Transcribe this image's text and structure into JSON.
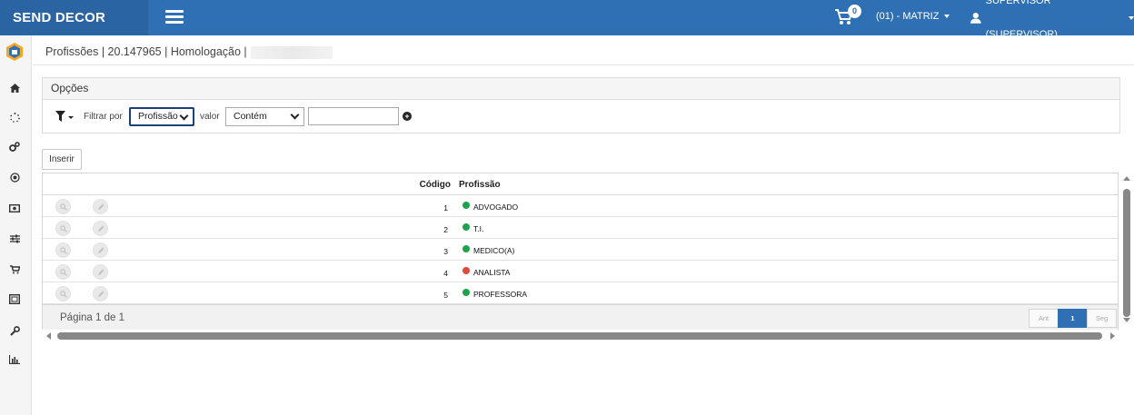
{
  "header": {
    "brand": "SEND DECOR",
    "cart_count": "0",
    "branch": "(01) - MATRIZ",
    "user": "SUPERVISOR (SUPERVISOR)",
    "colors": {
      "bar": "#2f6fb3",
      "brand_bg": "#2a64a3"
    }
  },
  "sidebar": {
    "items": [
      {
        "icon": "home-icon"
      },
      {
        "icon": "spinner-icon"
      },
      {
        "icon": "gears-icon"
      },
      {
        "icon": "target-icon"
      },
      {
        "icon": "money-icon"
      },
      {
        "icon": "sliders-icon"
      },
      {
        "icon": "cart-icon"
      },
      {
        "icon": "picture-icon"
      },
      {
        "icon": "wrench-icon"
      },
      {
        "icon": "bar-chart-icon"
      }
    ]
  },
  "breadcrumb": "Profissões | 20.147965 | Homologação |",
  "options": {
    "title": "Opções",
    "filter_label": "Filtrar por",
    "filter_field": "Profissão",
    "value_label": "valor",
    "operator": "Contém",
    "search_value": ""
  },
  "toolbar": {
    "insert_label": "Inserir"
  },
  "grid": {
    "columns": {
      "code": "Código",
      "profession": "Profissão"
    },
    "rows": [
      {
        "code": "1",
        "name": "ADVOGADO",
        "status_color": "#1fa24a"
      },
      {
        "code": "2",
        "name": "T.I.",
        "status_color": "#1fa24a"
      },
      {
        "code": "3",
        "name": "MEDICO(A)",
        "status_color": "#1fa24a"
      },
      {
        "code": "4",
        "name": "ANALISTA",
        "status_color": "#e04a3a"
      },
      {
        "code": "5",
        "name": "PROFESSORA",
        "status_color": "#1fa24a"
      }
    ],
    "page_info": "Página 1 de 1",
    "pager": {
      "prev": "Ant",
      "current": "1",
      "next": "Seg"
    }
  }
}
